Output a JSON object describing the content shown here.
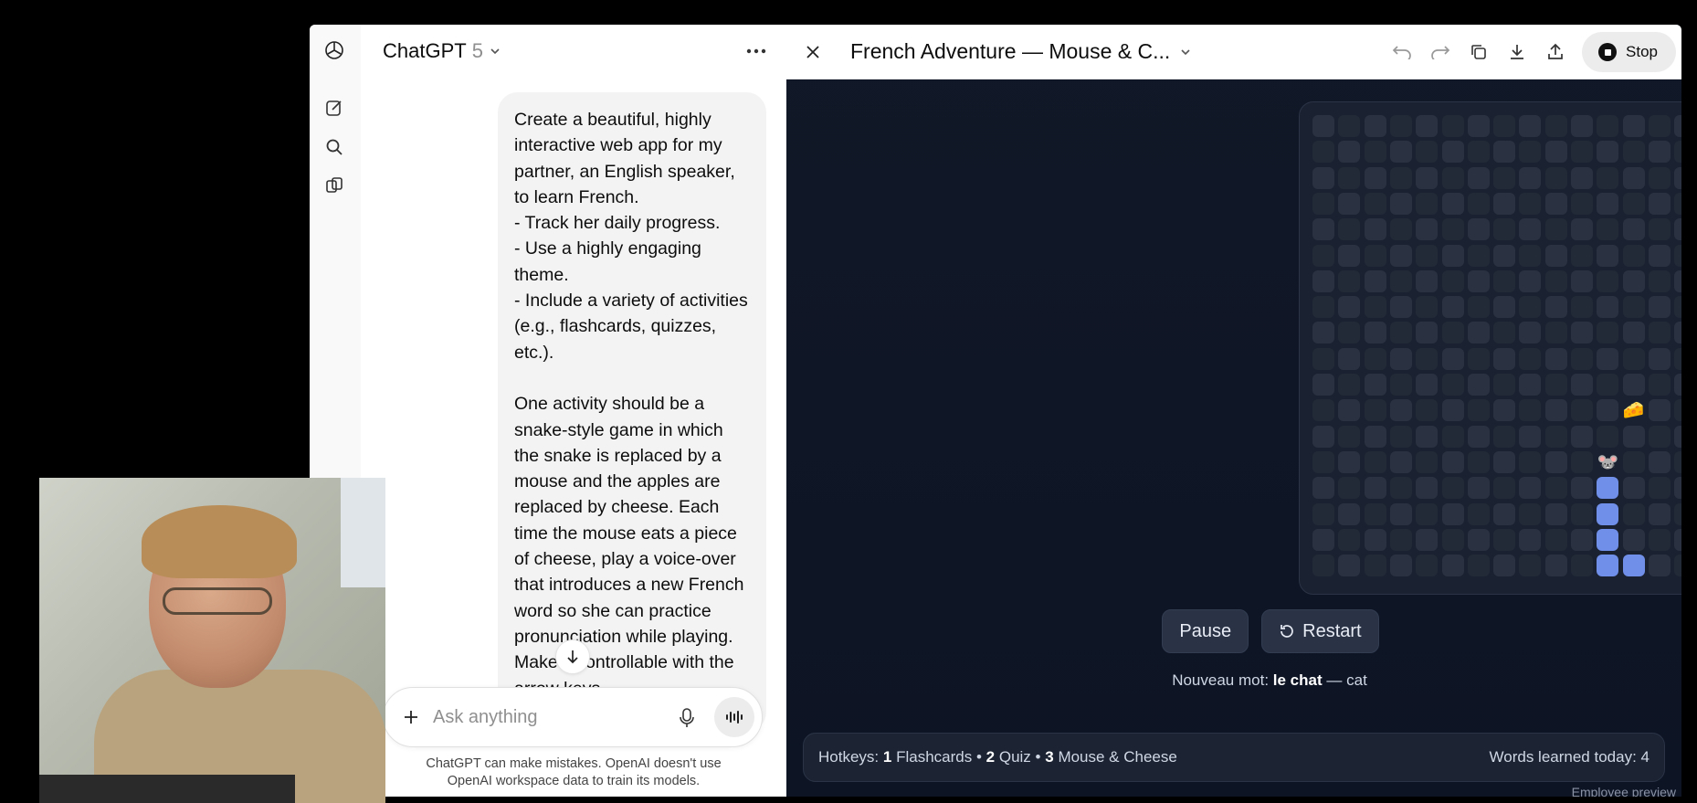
{
  "header": {
    "model_name": "ChatGPT",
    "model_version": "5"
  },
  "rail": {
    "items": [
      "new-chat",
      "search",
      "library"
    ]
  },
  "chat": {
    "user_message": "Create a beautiful, highly interactive web app for my partner, an English speaker, to learn French.\n- Track her daily progress.\n- Use a highly engaging theme.\n- Include a variety of activities (e.g., flashcards, quizzes, etc.).\n\nOne activity should be a snake-style game in which the snake is replaced by a mouse and the apples are replaced by cheese. Each time the mouse eats a piece of cheese, play a voice-over that introduces a new French word so she can practice pronunciation while playing. Make it controllable with the arrow keys.",
    "composer_placeholder": "Ask anything",
    "disclaimer": "ChatGPT can make mistakes. OpenAI doesn't use OpenAI workspace data to train its models."
  },
  "canvas": {
    "title": "French Adventure — Mouse & C...",
    "stop_label": "Stop",
    "pause_label": "Pause",
    "restart_label": "Restart",
    "word_prefix": "Nouveau mot:",
    "word_fr": "le chat",
    "word_sep": "—",
    "word_en": "cat",
    "hotkeys_label": "Hotkeys:",
    "hotkeys": [
      {
        "key": "1",
        "label": "Flashcards"
      },
      {
        "key": "2",
        "label": "Quiz"
      },
      {
        "key": "3",
        "label": "Mouse & Cheese"
      }
    ],
    "hotkey_sep": "•",
    "words_learned_label": "Words learned today:",
    "words_learned_count": "4",
    "preview_note": "Employee preview"
  },
  "game": {
    "grid_size": 18,
    "mouse": [
      11,
      13
    ],
    "cheese": [
      12,
      11
    ],
    "body": [
      [
        11,
        14
      ],
      [
        11,
        15
      ],
      [
        11,
        16
      ],
      [
        11,
        17
      ],
      [
        12,
        17
      ]
    ]
  },
  "colors": {
    "accent": "#6f8fe8",
    "canvas_bg": "#111827"
  }
}
